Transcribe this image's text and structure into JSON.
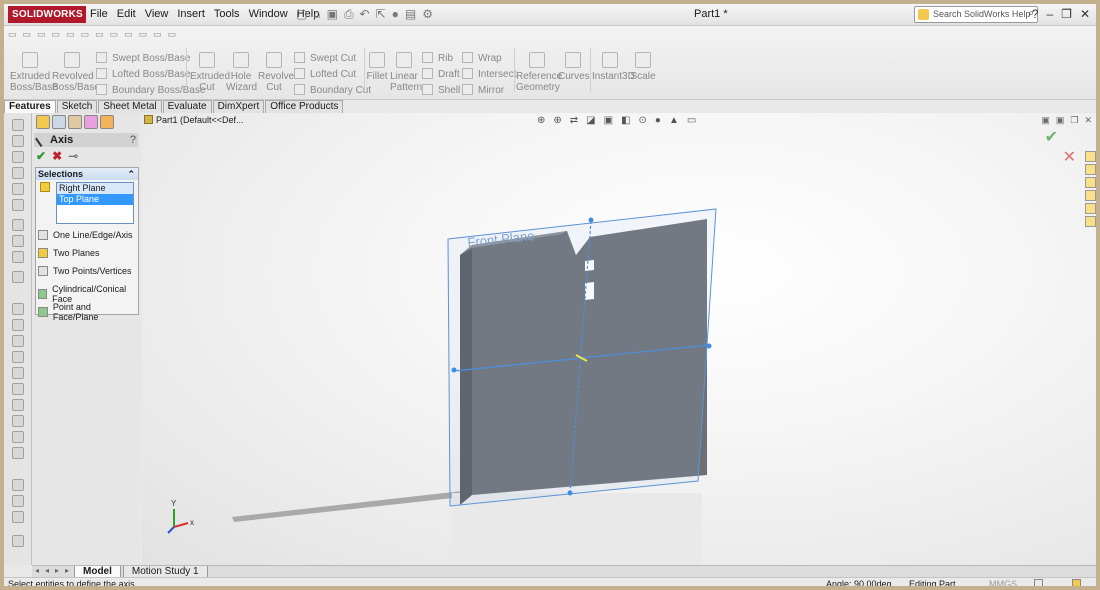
{
  "app": {
    "logo_text": "SOLIDWORKS",
    "document_title": "Part1 *"
  },
  "menu": [
    "File",
    "Edit",
    "View",
    "Insert",
    "Tools",
    "Window",
    "Help"
  ],
  "help_search": {
    "placeholder": "Search SolidWorks Help"
  },
  "commands": {
    "extruded_boss": "Extruded Boss/Base",
    "revolved_boss": "Revolved Boss/Base",
    "swept_boss": "Swept Boss/Base",
    "lofted_boss": "Lofted Boss/Base",
    "boundary_boss": "Boundary Boss/Base",
    "extruded_cut": "Extruded Cut",
    "hole_wizard": "Hole Wizard",
    "revolved_cut": "Revolved Cut",
    "swept_cut": "Swept Cut",
    "lofted_cut": "Lofted Cut",
    "boundary_cut": "Boundary Cut",
    "fillet": "Fillet",
    "linear_pattern": "Linear Pattern",
    "rib": "Rib",
    "draft": "Draft",
    "shell": "Shell",
    "wrap": "Wrap",
    "intersect": "Intersect",
    "mirror": "Mirror",
    "reference_geometry": "Reference Geometry",
    "curves": "Curves",
    "instant3d": "Instant3D",
    "scale": "Scale"
  },
  "tabs": [
    "Features",
    "Sketch",
    "Sheet Metal",
    "Evaluate",
    "DimXpert",
    "Office Products"
  ],
  "property_manager": {
    "title": "Axis",
    "help": "?",
    "selections": {
      "title": "Selections",
      "items": [
        "Right Plane",
        "Top Plane"
      ],
      "selected_index": 1
    },
    "options": [
      "One Line/Edge/Axis",
      "Two Planes",
      "Two Points/Vertices",
      "Cylindrical/Conical Face",
      "Point and Face/Plane"
    ]
  },
  "tree": {
    "label": "Part1  (Default<<Def..."
  },
  "viewport": {
    "plane_label": "Front Plane",
    "triad": {
      "x": "x",
      "y": "Y"
    }
  },
  "bottom_tabs": [
    "Model",
    "Motion Study 1"
  ],
  "status": {
    "message": "Select entities to define the axis",
    "angle": "Angle: 90.00deg",
    "mode": "Editing Part",
    "units": "MMGS"
  },
  "colors": {
    "accent": "#3399ff",
    "logo": "#b0182b",
    "plate": "#6c6f74"
  }
}
